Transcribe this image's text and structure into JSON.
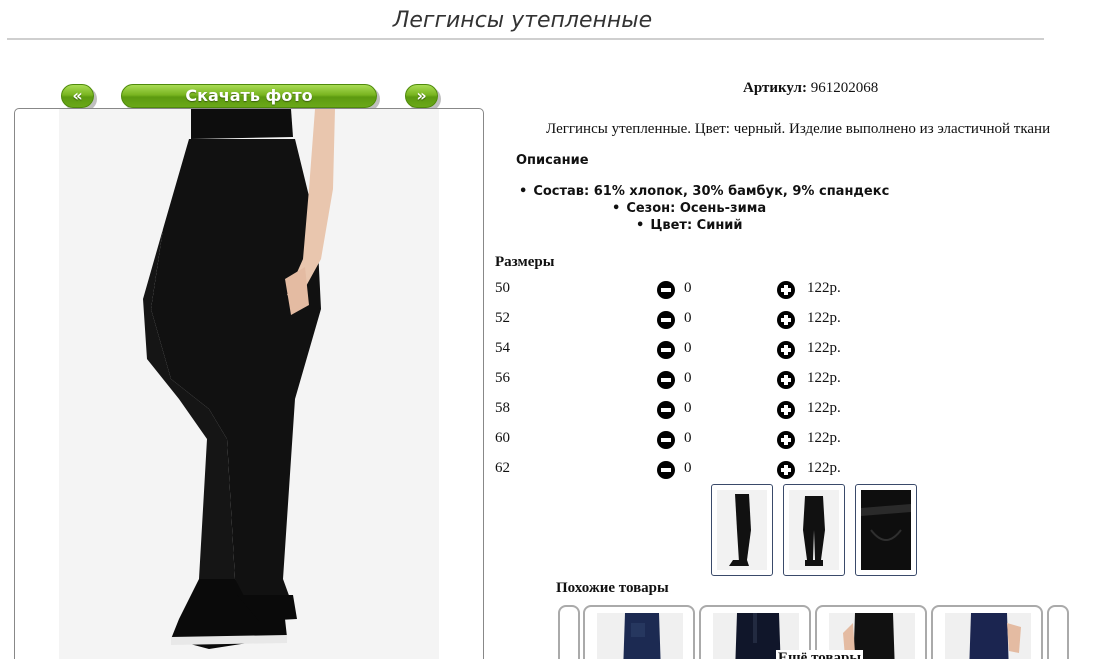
{
  "page": {
    "title": "Леггинсы утепленные"
  },
  "gallery": {
    "prev_label": "«",
    "download_label": "Скачать фото",
    "next_label": "»"
  },
  "product": {
    "article_label": "Артикул:",
    "article_value": "961202068",
    "description": "Леггинсы утепленные. Цвет: черный. Изделие выполнено из эластичной ткани",
    "specs_title": "Описание",
    "specs": [
      "Состав: 61% хлопок, 30% бамбук, 9% спандекс",
      "Сезон: Осень-зима",
      "Цвет: Синий"
    ]
  },
  "sizes": {
    "title": "Размеры",
    "rows": [
      {
        "size": "50",
        "qty": "0",
        "price": "122р."
      },
      {
        "size": "52",
        "qty": "0",
        "price": "122р."
      },
      {
        "size": "54",
        "qty": "0",
        "price": "122р."
      },
      {
        "size": "56",
        "qty": "0",
        "price": "122р."
      },
      {
        "size": "58",
        "qty": "0",
        "price": "122р."
      },
      {
        "size": "60",
        "qty": "0",
        "price": "122р."
      },
      {
        "size": "62",
        "qty": "0",
        "price": "122р."
      }
    ]
  },
  "similar": {
    "title": "Похожие товары",
    "more_title": "Ещё товары"
  },
  "colors": {
    "accent_green": "#79b520",
    "thumb_border": "#3a4a6a"
  }
}
